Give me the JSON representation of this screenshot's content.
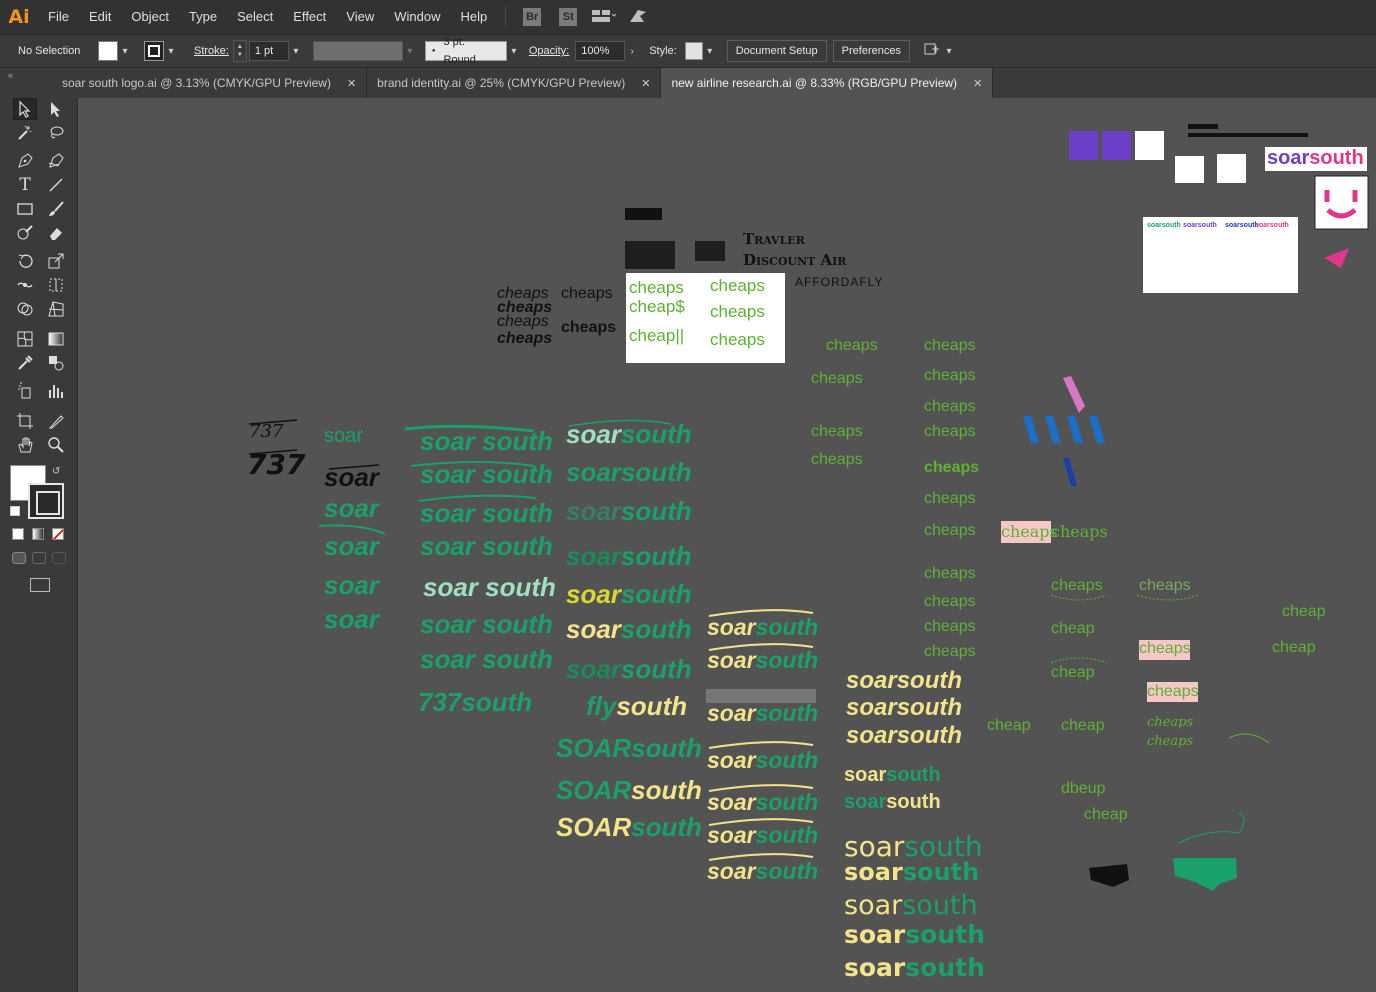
{
  "menubar": {
    "logo": "Ai",
    "items": [
      "File",
      "Edit",
      "Object",
      "Type",
      "Select",
      "Effect",
      "View",
      "Window",
      "Help"
    ],
    "badges": [
      "Br",
      "St"
    ]
  },
  "control": {
    "selection": "No Selection",
    "stroke_label": "Stroke:",
    "stroke_weight": "1 pt",
    "brush": "3 pt. Round",
    "opacity_label": "Opacity:",
    "opacity_value": "100%",
    "style_label": "Style:",
    "document_setup": "Document Setup",
    "preferences": "Preferences"
  },
  "tabs": [
    {
      "label": "soar south logo.ai @ 3.13% (CMYK/GPU Preview)",
      "active": false
    },
    {
      "label": "brand identity.ai @ 25% (CMYK/GPU Preview)",
      "active": false
    },
    {
      "label": "new airline research.ai @ 8.33% (RGB/GPU Preview)",
      "active": true
    }
  ],
  "canvas": {
    "wordmarks": {
      "travler": "Travler",
      "discount_air": "Discount Air",
      "affordafly": "AFFORDAFLY",
      "cheaps": "cheaps",
      "cheaps_dollar": "cheap$",
      "cheap_bars": "cheap||",
      "cheap": "cheap",
      "dbeup": "dbeup",
      "soar": "soar",
      "south": "south",
      "soar_south": "soar south",
      "soarsouth": "soarsouth",
      "soar_caps": "SOAR",
      "fly": "fly",
      "n737": "737",
      "n737south": "737south",
      "soarsouth_logo": "soarsouth",
      "soarsouth_small": "soarsouth"
    },
    "colors": {
      "green": "#1aa06a",
      "light_green": "#5fb036",
      "yellow": "#f3e48a",
      "mint": "#9fe0c0",
      "purple": "#6b3fc8",
      "pink": "#e0368c",
      "black": "#111111"
    }
  }
}
